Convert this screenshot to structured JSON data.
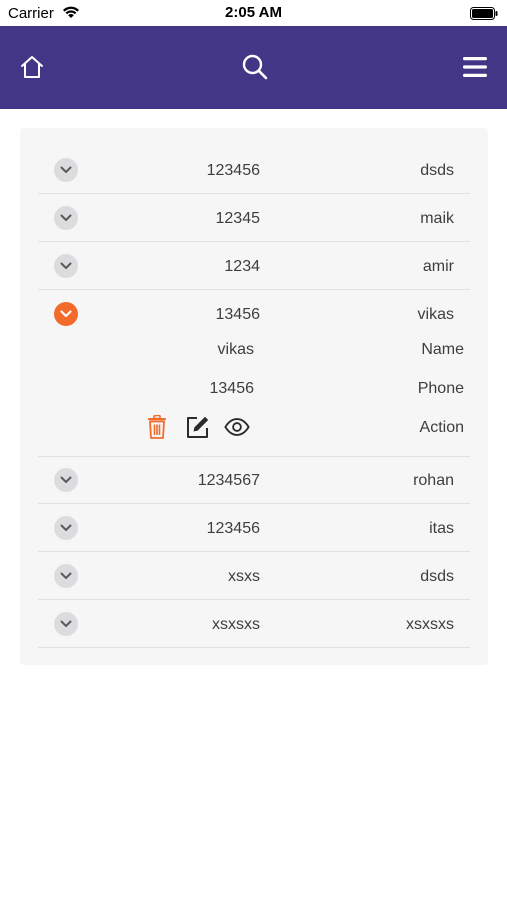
{
  "status_bar": {
    "carrier": "Carrier",
    "time": "2:05 AM"
  },
  "nav": {
    "home_icon": "home-icon",
    "search_icon": "search-icon",
    "menu_icon": "menu-icon"
  },
  "colors": {
    "nav_bg": "#433686",
    "accent": "#f26b2a",
    "card_bg": "#f6f6f6"
  },
  "rows": [
    {
      "number": "123456",
      "name": "dsds"
    },
    {
      "number": "12345",
      "name": "maik"
    },
    {
      "number": "1234",
      "name": "amir"
    },
    {
      "number": "13456",
      "name": "vikas",
      "expanded": true,
      "details": {
        "name_value": "vikas",
        "name_label": "Name",
        "phone_value": "13456",
        "phone_label": "Phone",
        "action_label": "Action"
      }
    },
    {
      "number": "1234567",
      "name": "rohan"
    },
    {
      "number": "123456",
      "name": "itas"
    },
    {
      "number": "xsxs",
      "name": "dsds"
    },
    {
      "number": "xsxsxs",
      "name": "xsxsxs"
    }
  ]
}
